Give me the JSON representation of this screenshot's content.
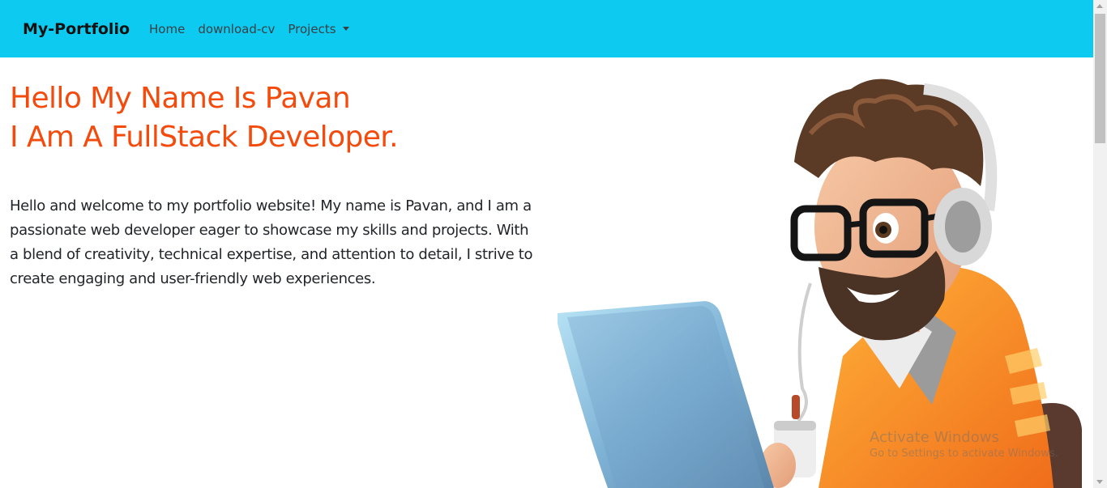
{
  "navbar": {
    "brand": "My-Portfolio",
    "links": [
      "Home",
      "download-cv",
      "Projects"
    ],
    "background": "#0dcaf0"
  },
  "hero": {
    "headline_line1": "Hello My Name Is Pavan",
    "headline_line2": "I Am A FullStack Developer.",
    "intro": "Hello and welcome to my portfolio website! My name is Pavan, and I am a passionate web developer eager to showcase my skills and projects. With a blend of creativity, technical expertise, and attention to detail, I strive to create engaging and user-friendly web experiences.",
    "accent_color": "#f44a0c"
  },
  "illustration": {
    "icon": "developer-avatar-illustration"
  },
  "watermark": {
    "title": "Activate Windows",
    "subtitle": "Go to Settings to activate Windows."
  }
}
